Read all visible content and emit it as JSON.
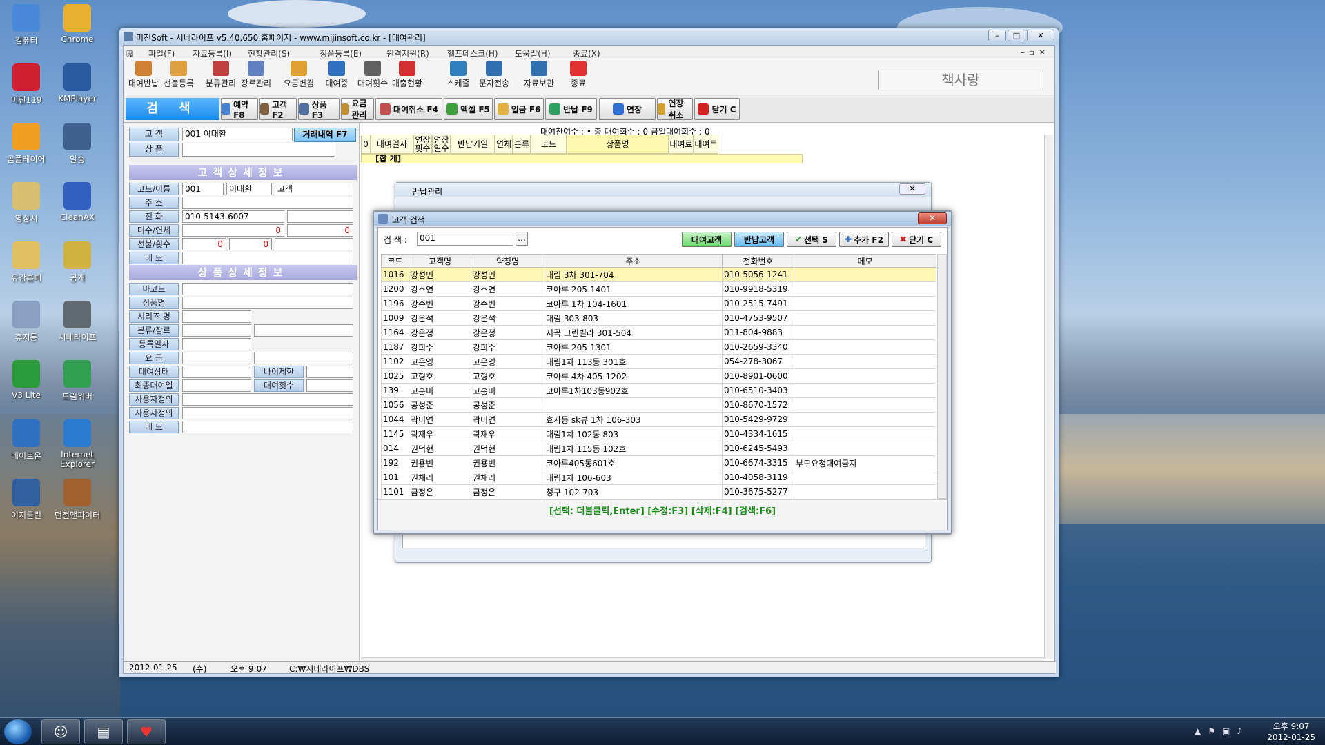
{
  "desktop": {
    "left_icons": [
      {
        "label": "컴퓨터",
        "icon": "computer-icon"
      },
      {
        "label": "Chrome",
        "icon": "chrome-icon"
      },
      {
        "label": "미진119",
        "icon": "heart-icon"
      },
      {
        "label": "KMPlayer",
        "icon": "kmplayer-icon"
      },
      {
        "label": "곰플레이어",
        "icon": "gomplayer-icon"
      },
      {
        "label": "알송",
        "icon": "alsong-icon"
      },
      {
        "label": "영상시",
        "icon": "folder-icon"
      },
      {
        "label": "CleanAX",
        "icon": "cleanax-icon"
      },
      {
        "label": "유강홈페",
        "icon": "folder-icon"
      },
      {
        "label": "공개",
        "icon": "folder-icon"
      },
      {
        "label": "휴지통",
        "icon": "recycle-bin-icon"
      },
      {
        "label": "시네라이프",
        "icon": "cinelife-icon"
      },
      {
        "label": "V3 Lite",
        "icon": "v3-icon"
      },
      {
        "label": "드림위버",
        "icon": "dreamweaver-icon"
      },
      {
        "label": "네이트온",
        "icon": "nateon-icon"
      },
      {
        "label": "Internet Explorer",
        "icon": "ie-icon"
      },
      {
        "label": "이지클린",
        "icon": "easyclean-icon"
      },
      {
        "label": "던전앤파이터",
        "icon": "game-icon"
      }
    ]
  },
  "window": {
    "title": "미진Soft - 시네라이프 v5.40.650 홈페이지 - www.mijinsoft.co.kr - [대여관리]",
    "menu": [
      "파일(F)",
      "자료등록(I)",
      "현황관리(S)",
      "정품등록(E)",
      "원격지원(R)",
      "헬프데스크(H)",
      "도움말(H)",
      "종료(X)"
    ],
    "tools": [
      "대여반납",
      "선불등록",
      "분류관리",
      "장르관리",
      "요금변경",
      "대여중",
      "대여횟수",
      "매출현황",
      "스케줄",
      "문자전송",
      "자료보관",
      "종료"
    ],
    "brand": "책사랑",
    "search_label": "검  색",
    "fbuttons": [
      "예약 F8",
      "고객 F2",
      "상품 F3",
      "요금 관리",
      "대여취소 F4",
      "엑셀 F5",
      "입금 F6",
      "반납 F9",
      "연장",
      "연장 취소",
      "닫기 C"
    ]
  },
  "left": {
    "customer_label": "고  객",
    "customer_value": "001 이대환",
    "history_btn": "거래내역 F7",
    "product_label": "상  품",
    "cust_section": "고객상세정보",
    "cust_rows": [
      {
        "label": "코드/이름",
        "v1": "001",
        "v2": "이대환",
        "v3": "고객"
      },
      {
        "label": "주  소",
        "v1": ""
      },
      {
        "label": "전  화",
        "v1": "010-5143-6007",
        "v2": ""
      },
      {
        "label": "미수/연체",
        "v1": "0",
        "v2": "0"
      },
      {
        "label": "선불/횟수",
        "v1": "0",
        "v2": "0",
        "v3": ""
      },
      {
        "label": "메  모",
        "v1": ""
      }
    ],
    "prod_section": "상품상세정보",
    "prod_rows": [
      "바코드",
      "상품명",
      "시리즈 명",
      "분류/장르",
      "등록일자",
      "요  금",
      "대여상태",
      "최종대여일",
      "사용자정의",
      "사용자정의",
      "메  모"
    ],
    "age_limit": "나이제한",
    "rent_count": "대여횟수"
  },
  "right": {
    "summary": "대여잔여수 : •      총 대여회수 : 0    금일대여회수 : 0",
    "headers": [
      "0",
      "대여일자",
      "연장 횟수",
      "연장 일수",
      "반납기일",
      "연체",
      "분류",
      "코드",
      "상품명",
      "대여료",
      "대여ᄐ"
    ],
    "total": "[합 계]"
  },
  "return_window": {
    "title": "반납관리"
  },
  "dialog": {
    "title": "고객 검색",
    "search_label": "검  색 :",
    "search_value": "001",
    "btn_rent": "대여고객",
    "btn_return": "반납고객",
    "btn_select": "선택 S",
    "btn_add": "추가 F2",
    "btn_close": "닫기 C",
    "columns": [
      "코드",
      "고객명",
      "약칭명",
      "주소",
      "전화번호",
      "메모"
    ],
    "rows": [
      [
        "1016",
        "강성민",
        "강성민",
        "대림 3차 301-704",
        "010-5056-1241",
        ""
      ],
      [
        "1200",
        "강소연",
        "강소연",
        "코아루 205-1401",
        "010-9918-5319",
        ""
      ],
      [
        "1196",
        "강수빈",
        "강수빈",
        "코아루 1차 104-1601",
        "010-2515-7491",
        ""
      ],
      [
        "1009",
        "강운석",
        "강운석",
        "대림 303-803",
        "010-4753-9507",
        ""
      ],
      [
        "1164",
        "강운정",
        "강운정",
        "지곡 그린빌라 301-504",
        "011-804-9883",
        ""
      ],
      [
        "1187",
        "강희수",
        "강희수",
        "코아루 205-1301",
        "010-2659-3340",
        ""
      ],
      [
        "1102",
        "고은영",
        "고은영",
        "대림1차 113동 301호",
        "054-278-3067",
        ""
      ],
      [
        "1025",
        "고형호",
        "고형호",
        "코아루 4차 405-1202",
        "010-8901-0600",
        ""
      ],
      [
        "139",
        "고홍비",
        "고홍비",
        "코아루1차103동902호",
        "010-6510-3403",
        ""
      ],
      [
        "1056",
        "공성준",
        "공성준",
        "",
        "010-8670-1572",
        ""
      ],
      [
        "1044",
        "곽미연",
        "곽미연",
        "효자동 sk뷰 1차 106-303",
        "010-5429-9729",
        ""
      ],
      [
        "1145",
        "곽재우",
        "곽재우",
        "대림1차 102동 803",
        "010-4334-1615",
        ""
      ],
      [
        "014",
        "권덕현",
        "권덕현",
        "대림1차 115동 102호",
        "010-6245-5493",
        ""
      ],
      [
        "192",
        "권용빈",
        "권용빈",
        "코아루405동601호",
        "010-6674-3315",
        "부모요청대여금지"
      ],
      [
        "101",
        "권채리",
        "권채리",
        "대림1차 106-603",
        "010-4058-3119",
        ""
      ],
      [
        "1101",
        "금정은",
        "금정은",
        "청구 102-703",
        "010-3675-5277",
        ""
      ]
    ],
    "hint": "[선택: 더블클릭,Enter]  [수정:F3]  [삭제:F4]  [검색:F6]"
  },
  "status": {
    "date": "2012-01-25",
    "day": "(수)",
    "time": "오후 9:07",
    "path": "C:₩시네라이프₩DBS"
  },
  "taskbar": {
    "time": "오후 9:07",
    "date": "2012-01-25"
  }
}
